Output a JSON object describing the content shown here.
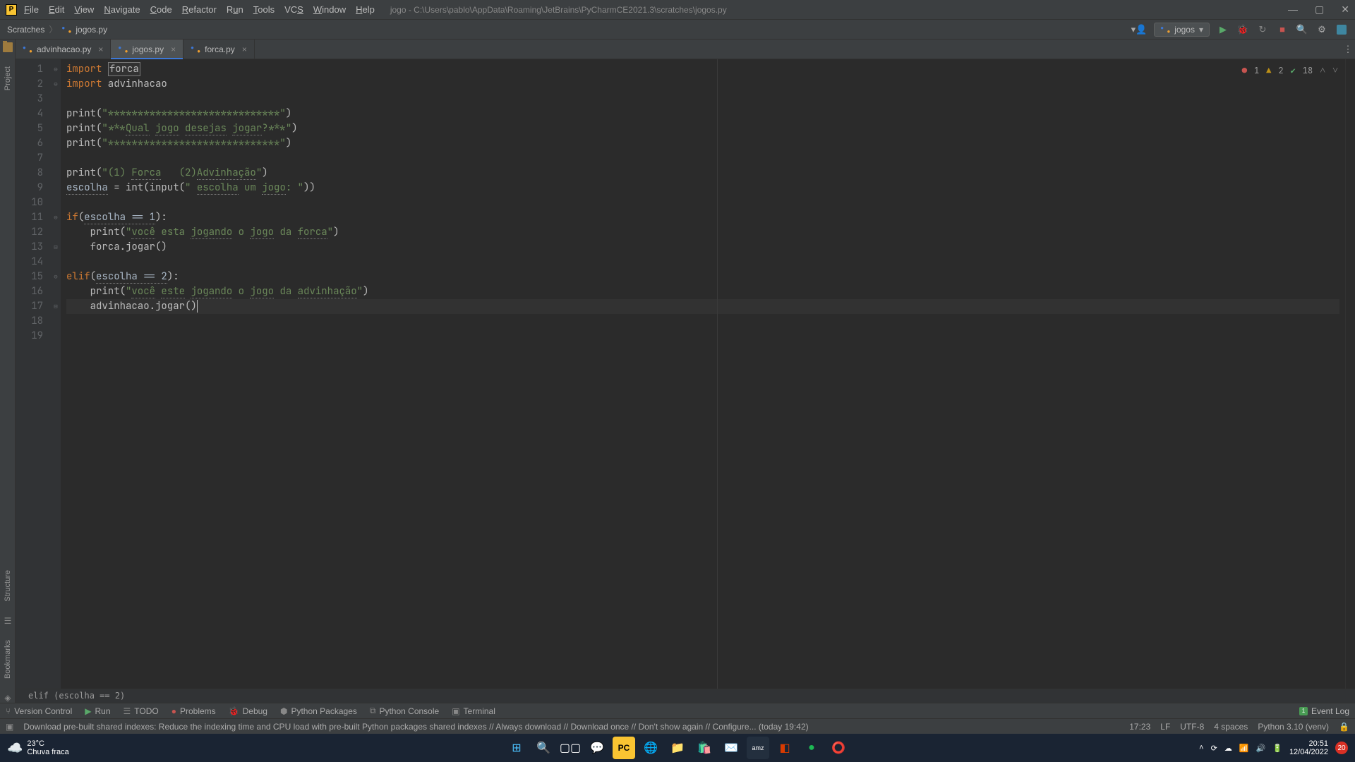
{
  "menu": [
    "File",
    "Edit",
    "View",
    "Navigate",
    "Code",
    "Refactor",
    "Run",
    "Tools",
    "VCS",
    "Window",
    "Help"
  ],
  "menu_underlines": [
    "F",
    "E",
    "V",
    "N",
    "C",
    "R",
    "R",
    "T",
    "V",
    "W",
    "H"
  ],
  "title": "jogo - C:\\Users\\pablo\\AppData\\Roaming\\JetBrains\\PyCharmCE2021.3\\scratches\\jogos.py",
  "breadcrumb": {
    "root": "Scratches",
    "file": "jogos.py"
  },
  "run_config": "jogos",
  "tabs": [
    {
      "name": "advinhacao.py",
      "active": false
    },
    {
      "name": "jogos.py",
      "active": true
    },
    {
      "name": "forca.py",
      "active": false
    }
  ],
  "left_tools": {
    "project": "Project",
    "structure": "Structure",
    "bookmarks": "Bookmarks"
  },
  "inspection": {
    "errors": "1",
    "warnings": "2",
    "typos": "18"
  },
  "code_lines": [
    {
      "n": "1",
      "html": "<span class='kw'>import</span> <span class='boxed'>forca</span>"
    },
    {
      "n": "2",
      "html": "<span class='kw'>import</span> advinhacao"
    },
    {
      "n": "3",
      "html": ""
    },
    {
      "n": "4",
      "html": "print(<span class='str'>\"*****************************\"</span>)"
    },
    {
      "n": "5",
      "html": "print(<span class='str'>\"***<span class='typo'>Qual</span> <span class='typo'>jogo</span> <span class='typo'>desejas</span> <span class='typo'>jogar</span>?***\"</span>)"
    },
    {
      "n": "6",
      "html": "print(<span class='str'>\"*****************************\"</span>)"
    },
    {
      "n": "7",
      "html": ""
    },
    {
      "n": "8",
      "html": "print(<span class='str'>\"(1) <span class='typo'>Forca</span>   (2)<span class='typo'>Advinhação</span>\"</span>)"
    },
    {
      "n": "9",
      "html": "<span class='typo' style='color:#a9b7c6'>escolha</span> = int(input(<span class='str'>\" <span class='typo'>escolha</span> um <span class='typo'>jogo</span>: \"</span>))"
    },
    {
      "n": "10",
      "html": ""
    },
    {
      "n": "11",
      "html": "<span class='kw'>if</span>(<span class='typo' style='color:#a9b7c6'>escolha == 1</span>):"
    },
    {
      "n": "12",
      "html": "    print(<span class='str'>\"<span class='typo'>você</span> esta <span class='typo'>jogando</span> o <span class='typo'>jogo</span> da <span class='typo'>forca</span>\"</span>)"
    },
    {
      "n": "13",
      "html": "    forca.jogar()"
    },
    {
      "n": "14",
      "html": ""
    },
    {
      "n": "15",
      "html": "<span class='kw'>elif</span>(<span class='typo' style='color:#a9b7c6'>escolha == 2</span>):"
    },
    {
      "n": "16",
      "html": "    print(<span class='str'>\"<span class='typo'>você</span> <span class='typo'>este</span> <span class='typo'>jogando</span> o <span class='typo'>jogo</span> da <span class='typo'>advinhação</span>\"</span>)"
    },
    {
      "n": "17",
      "html": "    advinhacao.jogar()<span class='caret'></span>",
      "cursor": true
    },
    {
      "n": "18",
      "html": ""
    },
    {
      "n": "19",
      "html": ""
    }
  ],
  "fold_marks": {
    "1": "⊖",
    "2": "⊖",
    "11": "⊖",
    "12": "",
    "13": "⊟",
    "15": "⊖",
    "17": "⊟"
  },
  "context": "elif (escolha == 2)",
  "tool_windows": {
    "vc": "Version Control",
    "run": "Run",
    "todo": "TODO",
    "problems": "Problems",
    "debug": "Debug",
    "pypkg": "Python Packages",
    "pycon": "Python Console",
    "term": "Terminal",
    "eventlog": "Event Log"
  },
  "status": {
    "msg": "Download pre-built shared indexes: Reduce the indexing time and CPU load with pre-built Python packages shared indexes // Always download // Download once // Don't show again // Configure... (today 19:42)",
    "pos": "17:23",
    "sep": "LF",
    "enc": "UTF-8",
    "indent": "4 spaces",
    "py": "Python 3.10 (venv)"
  },
  "taskbar": {
    "weather_temp": "23°C",
    "weather_desc": "Chuva fraca",
    "time": "20:51",
    "date": "12/04/2022",
    "notif": "20"
  }
}
